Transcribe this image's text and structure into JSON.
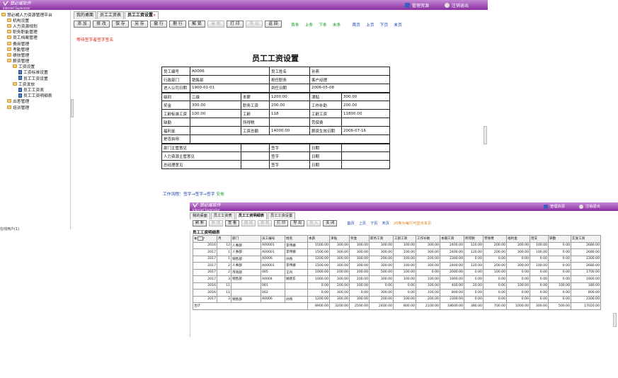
{
  "app": {
    "logo_name": "慧必威软件",
    "logo_sub": "Internet Supervisor",
    "manage_label": "管理资源",
    "logout_label": "注销退出",
    "colors": {
      "header": "#8a2f9f",
      "link": "#1640b0",
      "green": "#1a9c2a",
      "notice": "#d21",
      "orange": "#e07a10"
    }
  },
  "sidebar": {
    "items": [
      {
        "label": "慧必威人力资源管理平台",
        "level": 0,
        "icon": "folder-icon"
      },
      {
        "label": "机构设置",
        "level": 1,
        "icon": "folder-icon"
      },
      {
        "label": "人力资源规划",
        "level": 1,
        "icon": "folder-icon"
      },
      {
        "label": "职务职能管理",
        "level": 1,
        "icon": "folder-icon"
      },
      {
        "label": "员工档案管理",
        "level": 1,
        "icon": "folder-icon"
      },
      {
        "label": "费用管理",
        "level": 1,
        "icon": "folder-icon"
      },
      {
        "label": "考勤管理",
        "level": 1,
        "icon": "folder-icon"
      },
      {
        "label": "绩效管理",
        "level": 1,
        "icon": "folder-icon"
      },
      {
        "label": "薪资管理",
        "level": 1,
        "icon": "folder-icon"
      },
      {
        "label": "工资设置",
        "level": 2,
        "icon": "folder-icon"
      },
      {
        "label": "工资标准设置",
        "level": 3,
        "icon": "doc-icon"
      },
      {
        "label": "员工工资设置",
        "level": 3,
        "icon": "doc-icon"
      },
      {
        "label": "工资发放",
        "level": 2,
        "icon": "folder-icon"
      },
      {
        "label": "员工工资表",
        "level": 3,
        "icon": "doc-icon"
      },
      {
        "label": "员工工资明细表",
        "level": 3,
        "icon": "doc-icon"
      },
      {
        "label": "出差管理",
        "level": 1,
        "icon": "folder-icon"
      },
      {
        "label": "培训管理",
        "level": 1,
        "icon": "folder-icon"
      }
    ],
    "status": "在线用户(1)"
  },
  "window1": {
    "tabs": [
      {
        "label": "我的桌面",
        "active": false
      },
      {
        "label": "员工工资表",
        "active": false
      },
      {
        "label": "员工工资设置",
        "active": true
      }
    ],
    "tab_close": "×",
    "buttons": [
      {
        "label": "添 加",
        "enabled": true
      },
      {
        "label": "修 改",
        "enabled": true
      },
      {
        "label": "保 存",
        "enabled": true
      },
      {
        "label": "另 存",
        "enabled": true
      },
      {
        "label": "撤 行",
        "enabled": true
      },
      {
        "label": "删 行",
        "enabled": true
      },
      {
        "label": "解 锁",
        "enabled": true
      },
      {
        "label": "审 核",
        "enabled": false
      },
      {
        "label": "打 印",
        "enabled": true
      },
      {
        "label": "导 出",
        "enabled": false
      },
      {
        "label": "返 回",
        "enabled": true
      }
    ],
    "record_nav": [
      "首条",
      "上条",
      "下条",
      "末条"
    ],
    "page_nav": [
      "首页",
      "上页",
      "下页",
      "末页"
    ],
    "notice": "等待签字者签字签名",
    "title": "员工工资设置",
    "form": {
      "emp_no_label": "员工编号",
      "emp_no": "A0006",
      "emp_name_label": "员工姓名",
      "emp_name": "孙燕",
      "dept_label": "行政部门",
      "dept": "销售部",
      "post_label": "担任职务",
      "post": "客户经理",
      "join_label": "进入公司日期",
      "join": "1900-01-01",
      "arrive_label": "到任日期",
      "arrive": "2006-05-08",
      "grade_label": "级别",
      "grade": "二级",
      "base_label": "本薪",
      "base": "1200.00",
      "allow_label": "津贴",
      "allow": "300.00",
      "bonus_label": "奖金",
      "bonus": "300.00",
      "duty_label": "职务工资",
      "duty": "200.00",
      "worksub_label": "工作补助",
      "worksub": "200.00",
      "seniority_std_label": "工龄标准工资",
      "seniority_std": "100.00",
      "seniority_label": "工龄",
      "seniority": "118",
      "seniority_pay_label": "工龄工资",
      "seniority_pay": "11800.00",
      "absence_label": "缺勤",
      "absence": "",
      "tax_label": "所得税",
      "tax": "",
      "labor_label": "劳保费",
      "labor": "",
      "welfare_label": "福利金",
      "welfare": "",
      "total_label": "工资总额",
      "total": "14000.00",
      "effective_label": "薪资生效日期",
      "effective": "2006-07-16",
      "enabled_label": "是否启用",
      "enabled": "",
      "sign": [
        {
          "label": "部门主管意见",
          "sign_label": "签字",
          "date_label": "日期"
        },
        {
          "label": "人力资源主管意见",
          "sign_label": "签字",
          "date_label": "日期"
        },
        {
          "label": "总经理意见",
          "sign_label": "签字",
          "date_label": "日期"
        }
      ]
    },
    "flow_prefix": "工作流程：",
    "flow_steps": "签字→签字→签字",
    "flow_done": "安卷"
  },
  "window2": {
    "tabs": [
      {
        "label": "我的桌面",
        "active": false
      },
      {
        "label": "员工工资表",
        "active": false
      },
      {
        "label": "员工工资明细表",
        "active": true
      },
      {
        "label": "员工工资设置",
        "active": false
      }
    ],
    "buttons": [
      {
        "label": "刷 新",
        "enabled": true
      },
      {
        "label": "新 增",
        "enabled": false
      },
      {
        "label": "查 看",
        "enabled": true
      },
      {
        "label": "删 除",
        "enabled": false
      },
      {
        "label": "审 核",
        "enabled": false
      },
      {
        "label": "打 印",
        "enabled": true
      },
      {
        "label": "导 出",
        "enabled": true
      },
      {
        "label": "导 入",
        "enabled": false
      },
      {
        "label": "关 闭",
        "enabled": true
      }
    ],
    "page_nav": [
      "首页",
      "上页",
      "下页",
      "末页"
    ],
    "note": "20条为每行可显示本页",
    "list_title": "员工工资明细表",
    "columns": [
      "年",
      "月",
      "部门",
      "员工编号",
      "姓名",
      "本薪",
      "津贴",
      "奖金",
      "职务工资",
      "工龄工资",
      "工作补助",
      "本期工资",
      "所得税",
      "劳保费",
      "福利金",
      "借支",
      "缺勤",
      "实发工资"
    ],
    "rows": [
      [
        "2016",
        "12",
        "人事部",
        "A00001",
        "李伟娜",
        "1500.00",
        "300.00",
        "300.00",
        "300.00",
        "100.00",
        "300.00",
        "2400.00",
        "120.00",
        "200.00",
        "300.00",
        "100.00",
        "0.00",
        "2680.00"
      ],
      [
        "2017",
        "1",
        "人事部",
        "A00001",
        "李伟娜",
        "1500.00",
        "300.00",
        "300.00",
        "300.00",
        "100.00",
        "300.00",
        "2400.00",
        "120.00",
        "200.00",
        "300.00",
        "100.00",
        "0.00",
        "2680.00"
      ],
      [
        "2017",
        "1",
        "销售部",
        "A0006",
        "孙燕",
        "1200.00",
        "300.00",
        "300.00",
        "200.00",
        "100.00",
        "200.00",
        "2300.00",
        "0.00",
        "0.00",
        "0.00",
        "0.00",
        "0.00",
        "2300.00"
      ],
      [
        "2017",
        "2",
        "人事部",
        "A00001",
        "李伟娜",
        "1500.00",
        "300.00",
        "300.00",
        "300.00",
        "100.00",
        "300.00",
        "2400.00",
        "120.00",
        "200.00",
        "300.00",
        "100.00",
        "0.00",
        "2680.00"
      ],
      [
        "2017",
        "2",
        "市场部",
        "005",
        "王丹",
        "1000.00",
        "200.00",
        "200.00",
        "500.00",
        "100.00",
        "0.00",
        "2000.00",
        "0.00",
        "100.00",
        "0.00",
        "0.00",
        "0.00",
        "1700.00"
      ],
      [
        "2017",
        "3",
        "销售部",
        "A0004",
        "姚晓东",
        "1000.00",
        "300.00",
        "200.00",
        "300.00",
        "100.00",
        "100.00",
        "1900.00",
        "0.00",
        "0.00",
        "0.00",
        "0.00",
        "0.00",
        "1900.00"
      ],
      [
        "2016",
        "11",
        "",
        "001",
        "",
        "0.00",
        "200.00",
        "100.00",
        "0.00",
        "0.00",
        "100.00",
        "400.00",
        "20.00",
        "0.00",
        "100.00",
        "0.00",
        "100.00",
        "180.00"
      ],
      [
        "2016",
        "11",
        "",
        "002",
        "",
        "0.00",
        "300.00",
        "0.00",
        "300.00",
        "0.00",
        "100.00",
        "800.00",
        "0.00",
        "0.00",
        "0.00",
        "0.00",
        "0.00",
        "800.00"
      ],
      [
        "2017",
        "3",
        "销售部",
        "A0006",
        "孙燕",
        "1200.00",
        "300.00",
        "300.00",
        "200.00",
        "100.00",
        "200.00",
        "2300.00",
        "0.00",
        "0.00",
        "0.00",
        "0.00",
        "0.00",
        "2300.00"
      ]
    ],
    "total_label": "合计",
    "totals": [
      "8900.00",
      "3200.00",
      "2500.00",
      "2400.00",
      "800.00",
      "2100.00",
      "18600.00",
      "380.00",
      "700.00",
      "1000.00",
      "300.00",
      "500.00",
      "17020.00"
    ],
    "year_sort": "?"
  }
}
